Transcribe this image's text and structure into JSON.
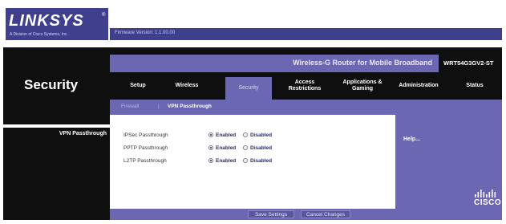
{
  "brand": {
    "logo": "LINKSYS",
    "subtitle": "A Division of Cisco Systems, Inc.",
    "firmware": "Firmware Version: 1.1.00.00"
  },
  "product": {
    "name": "Wireless-G Router for Mobile Broadband",
    "model": "WRT54G3GV2-ST"
  },
  "section_title": "Security",
  "tabs": [
    {
      "label": "Setup"
    },
    {
      "label": "Wireless"
    },
    {
      "label": "Security",
      "active": true
    },
    {
      "label": "Access\nRestrictions"
    },
    {
      "label": "Applications &\nGaming"
    },
    {
      "label": "Administration"
    },
    {
      "label": "Status"
    }
  ],
  "subnav": {
    "firewall": "Firewall",
    "separator": "|",
    "vpn": "VPN Passthrough"
  },
  "left_label": "VPN Passthrough",
  "settings": [
    {
      "label": "IPSec Passthrough",
      "enabled_label": "Enabled",
      "disabled_label": "Disabled",
      "value": "Enabled"
    },
    {
      "label": "PPTP Passthrough",
      "enabled_label": "Enabled",
      "disabled_label": "Disabled",
      "value": "Enabled"
    },
    {
      "label": "L2TP Passthrough",
      "enabled_label": "Enabled",
      "disabled_label": "Disabled",
      "value": "Enabled"
    }
  ],
  "help_link": "Help...",
  "cisco": "CISCO",
  "buttons": {
    "save": "Save Settings",
    "cancel": "Cancel Changes"
  },
  "colors": {
    "accent": "#6c67b3",
    "brand": "#3f3f8e",
    "background": "#0f0f0f"
  }
}
